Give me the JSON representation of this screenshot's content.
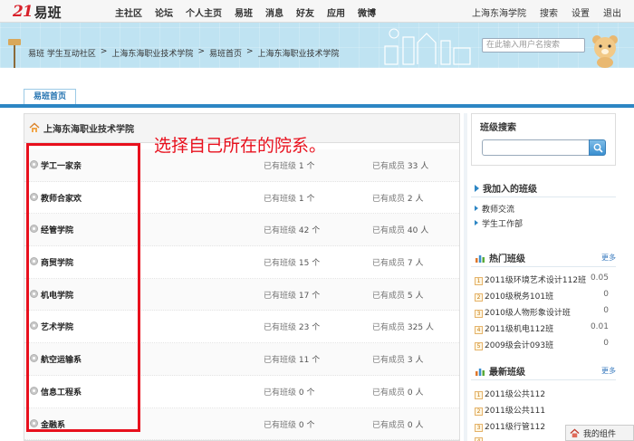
{
  "brand": {
    "mark": "21",
    "name": "易班"
  },
  "nav": [
    "主社区",
    "论坛",
    "个人主页",
    "易班",
    "消息",
    "好友",
    "应用",
    "微博"
  ],
  "toplinks": [
    "上海东海学院",
    "搜索",
    "设置",
    "退出"
  ],
  "breadcrumb": [
    "易班 学生互动社区",
    "上海东海职业技术学院",
    "易班首页",
    "上海东海职业技术学院"
  ],
  "breadcrumb_sep": ">",
  "search": {
    "placeholder": "在此输入用户名搜索"
  },
  "tab": {
    "label": "易班首页"
  },
  "main": {
    "title": "上海东海职业技术学院",
    "annotation": "选择自己所在的院系。",
    "class_label": "已有班级",
    "member_label": "已有成员",
    "rows": [
      {
        "name": "学工一家亲",
        "classes": "1 个",
        "members": "33 人"
      },
      {
        "name": "教师合家欢",
        "classes": "1 个",
        "members": "2 人"
      },
      {
        "name": "经管学院",
        "classes": "42 个",
        "members": "40 人"
      },
      {
        "name": "商贸学院",
        "classes": "15 个",
        "members": "7 人"
      },
      {
        "name": "机电学院",
        "classes": "17 个",
        "members": "5 人"
      },
      {
        "name": "艺术学院",
        "classes": "23 个",
        "members": "325 人"
      },
      {
        "name": "航空运输系",
        "classes": "11 个",
        "members": "3 人"
      },
      {
        "name": "信息工程系",
        "classes": "0 个",
        "members": "0 人"
      },
      {
        "name": "金融系",
        "classes": "0 个",
        "members": "0 人"
      }
    ]
  },
  "sidebar": {
    "search_title": "班级搜索",
    "joined_title": "我加入的班级",
    "joined": [
      "教师交流",
      "学生工作部"
    ],
    "hot_title": "热门班级",
    "hot_more": "更多",
    "hot": [
      {
        "rank": "1",
        "name": "2011级环境艺术设计112班",
        "value": "0.05"
      },
      {
        "rank": "2",
        "name": "2010级税务101班",
        "value": "0"
      },
      {
        "rank": "3",
        "name": "2010级人物形象设计班",
        "value": "0"
      },
      {
        "rank": "4",
        "name": "2011级机电112班",
        "value": "0.01"
      },
      {
        "rank": "5",
        "name": "2009级会计093班",
        "value": "0"
      }
    ],
    "new_title": "最新班级",
    "new_more": "更多",
    "new": [
      {
        "rank": "1",
        "name": "2011级公共112"
      },
      {
        "rank": "2",
        "name": "2011级公共111"
      },
      {
        "rank": "3",
        "name": "2011级行管112"
      },
      {
        "rank": "4",
        "name": ""
      }
    ]
  },
  "widget": {
    "label": "我的组件"
  }
}
